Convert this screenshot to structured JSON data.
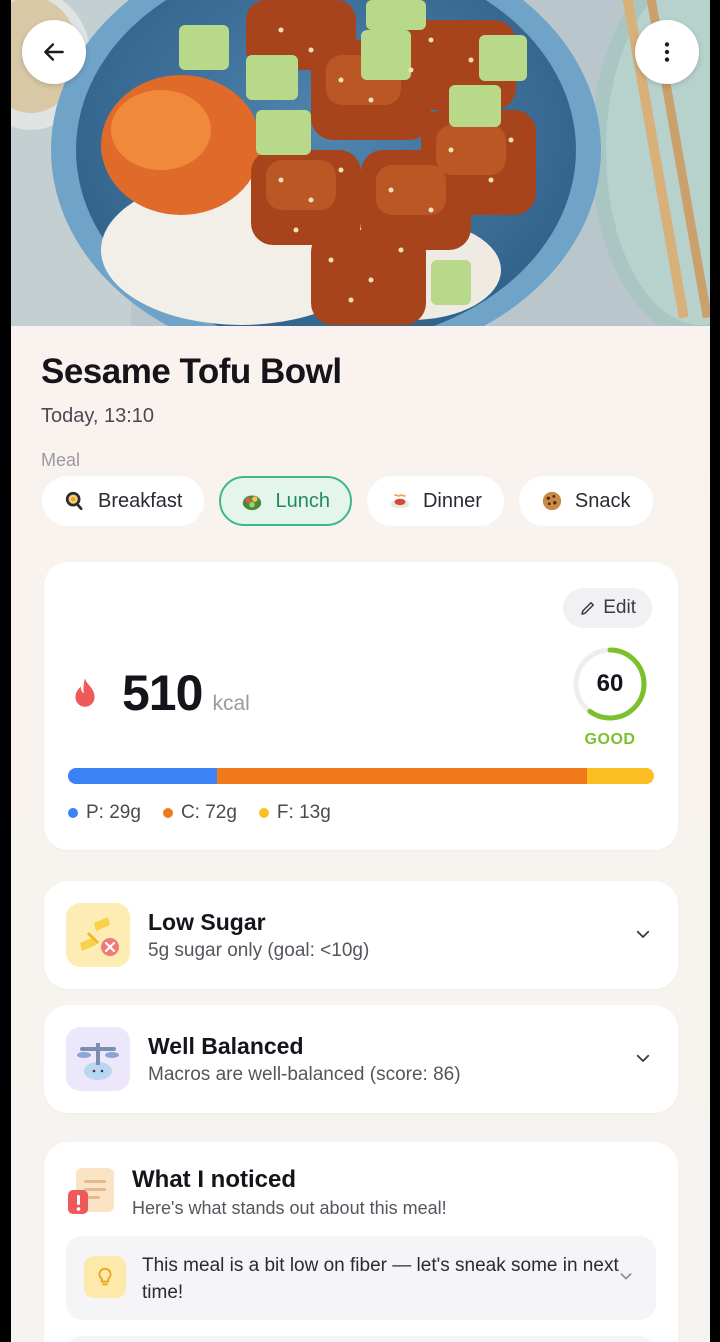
{
  "header": {
    "back_icon": "arrow-left-icon",
    "more_icon": "more-vertical-icon",
    "hero_image": "sesame tofu bowl photo"
  },
  "meal": {
    "title": "Sesame Tofu Bowl",
    "timestamp": "Today, 13:10",
    "section_label": "Meal",
    "types": [
      {
        "label": "Breakfast",
        "icon": "breakfast-icon",
        "selected": false
      },
      {
        "label": "Lunch",
        "icon": "lunch-icon",
        "selected": true
      },
      {
        "label": "Dinner",
        "icon": "dinner-icon",
        "selected": false
      },
      {
        "label": "Snack",
        "icon": "cookie-icon",
        "selected": false
      }
    ]
  },
  "nutrition": {
    "edit_label": "Edit",
    "calories": "510",
    "calories_unit": "kcal",
    "score": "60",
    "score_label": "GOOD",
    "score_fraction": 0.6,
    "macros": [
      {
        "label": "P: 29g",
        "grams": 29,
        "color": "#3b82f6"
      },
      {
        "label": "C: 72g",
        "grams": 72,
        "color": "#f07a1a"
      },
      {
        "label": "F: 13g",
        "grams": 13,
        "color": "#fbbf24"
      }
    ]
  },
  "insights": [
    {
      "title": "Low Sugar",
      "subtitle": "5g sugar only (goal: <10g)",
      "icon": "low-sugar-icon"
    },
    {
      "title": "Well Balanced",
      "subtitle": "Macros are well-balanced (score: 86)",
      "icon": "balance-scale-icon"
    }
  ],
  "noticed": {
    "title": "What I noticed",
    "subtitle": "Here's what stands out about this meal!",
    "tips": [
      {
        "text": "This meal is a bit low on fiber — let's sneak some in next time!",
        "icon": "lightbulb-icon"
      }
    ]
  },
  "colors": {
    "accent_green": "#3fb885",
    "score_green": "#7cc12c",
    "flame_red": "#f0595a"
  }
}
